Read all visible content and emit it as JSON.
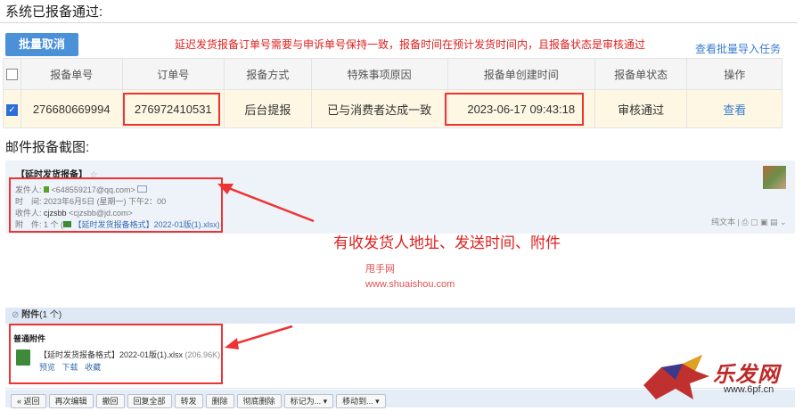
{
  "section1": {
    "title": "系统已报备通过:"
  },
  "toolbar": {
    "batch_cancel": "批量取消",
    "notice": "延迟发货报备订单号需要与申诉单号保持一致，报备时间在预计发货时间内，且报备状态是审核通过",
    "batch_import_link": "查看批量导入任务"
  },
  "table": {
    "headers": [
      "报备单号",
      "订单号",
      "报备方式",
      "特殊事项原因",
      "报备单创建时间",
      "报备单状态",
      "操作"
    ],
    "row": {
      "report_no": "276680669994",
      "order_no": "276972410531",
      "method": "后台提报",
      "reason": "已与消费者达成一致",
      "created": "2023-06-17 09:43:18",
      "status": "审核通过",
      "action": "查看"
    }
  },
  "section2": {
    "title": "邮件报备截图:"
  },
  "mail": {
    "subject": "【延时发货报备】",
    "from_label": "发件人:",
    "from": "<648559217@qq.com>",
    "time_label": "时　间:",
    "time": "2023年6月5日 (星期一) 下午2：00",
    "to_label": "收件人:",
    "to_name": "cjzsbb",
    "to_addr": "<cjzsbb@jd.com>",
    "attach_label": "附　件:",
    "attach_count": "1 个",
    "attach_name": "【延时发货报备格式】2022-01版(1).xlsx)",
    "right_tools": "纯文本 | ⎙ ▢ ▣ ▤ ⌄"
  },
  "annotation": "有收发货人地址、发送时间、附件",
  "watermark": {
    "line1": "甩手网",
    "line2": "www.shuaishou.com"
  },
  "attachments": {
    "header": "附件",
    "count": "(1 个)",
    "section": "普通附件",
    "file_name": "【延时发货报备格式】2022-01版(1).xlsx",
    "file_size": "(206.96K)",
    "actions": [
      "预览",
      "下载",
      "收藏"
    ]
  },
  "buttons": [
    "« 返回",
    "再次编辑",
    "撤回",
    "回复全部",
    "转发",
    "删除",
    "彻底删除",
    "标记为... ▾",
    "移动到... ▾"
  ],
  "logo": {
    "text": "乐发网",
    "url": "www.6pf.cn"
  }
}
